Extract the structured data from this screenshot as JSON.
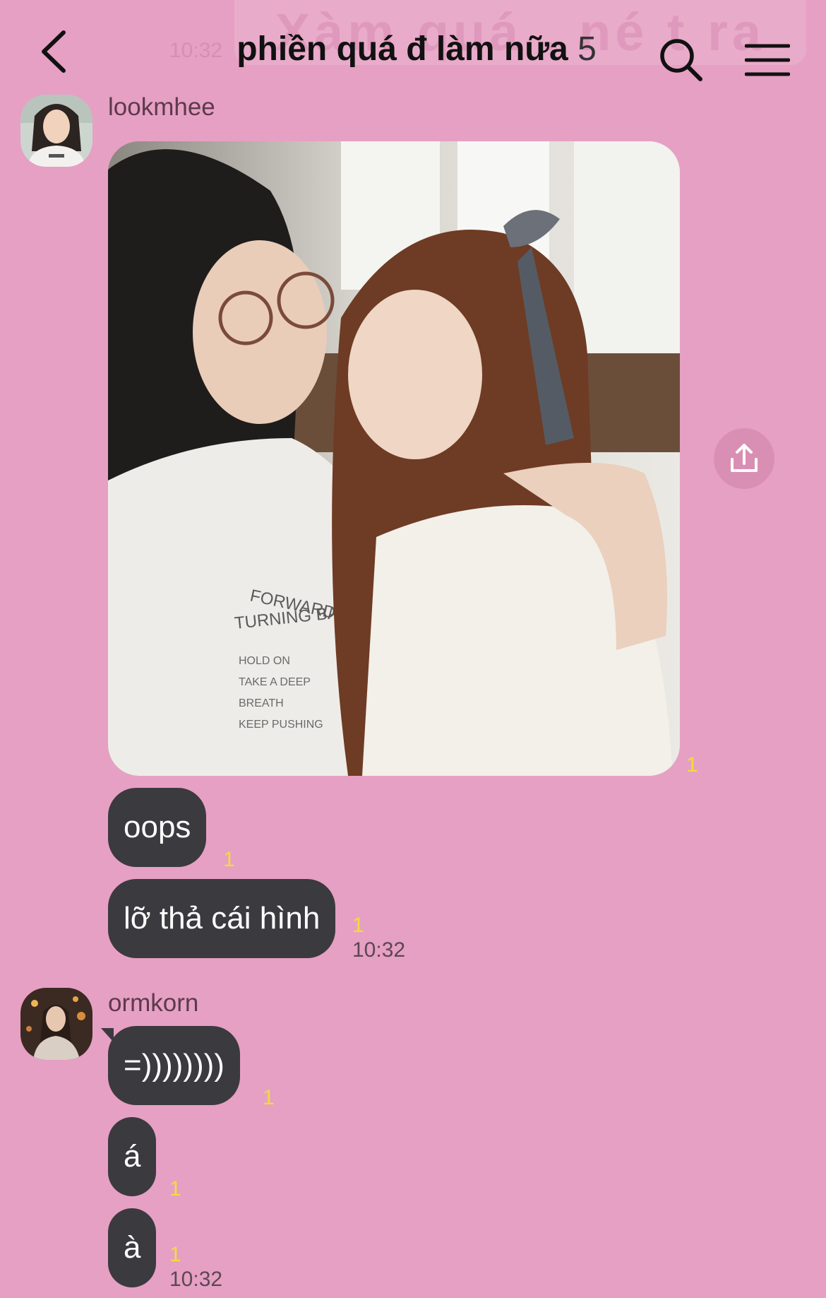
{
  "header": {
    "ghost_banner_text": "Xàm quá . né t ra",
    "ghost_banner_time": "10:32",
    "title": "phiền quá đ làm nữa",
    "member_count": "5",
    "back_icon": "chevron-left-icon",
    "search_icon": "search-icon",
    "menu_icon": "hamburger-menu-icon"
  },
  "groups": [
    {
      "sender": "lookmhee",
      "messages": [
        {
          "type": "image",
          "unread": "1"
        },
        {
          "type": "text",
          "text": "oops",
          "unread": "1"
        },
        {
          "type": "text",
          "text": "lỡ thả cái hình",
          "unread": "1",
          "time": "10:32"
        }
      ]
    },
    {
      "sender": "ormkorn",
      "messages": [
        {
          "type": "text",
          "text": "=))))))))",
          "unread": "1"
        },
        {
          "type": "text",
          "text": "á",
          "unread": "1"
        },
        {
          "type": "text",
          "text": "à",
          "unread": "1",
          "time": "10:32"
        }
      ]
    }
  ],
  "share_icon": "share-upload-icon",
  "colors": {
    "background": "#e6a0c3",
    "bubble": "#3b3a3f",
    "bubble_text": "#ffffff",
    "unread_count": "#f2dc3a"
  }
}
